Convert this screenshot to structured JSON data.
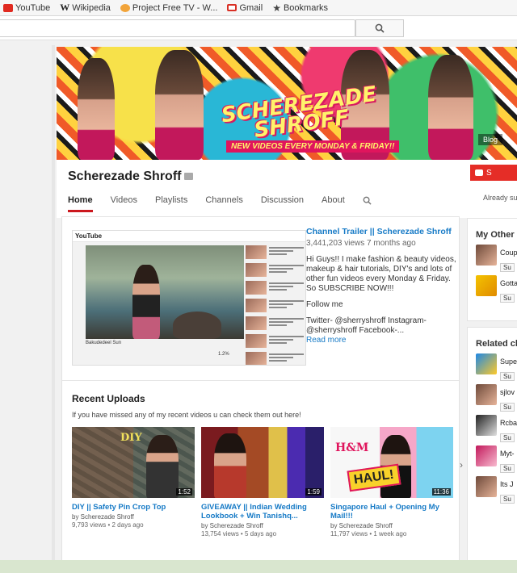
{
  "bookmarks": [
    {
      "label": "YouTube",
      "icon": "youtube-icon"
    },
    {
      "label": "Wikipedia",
      "icon": "wikipedia-icon"
    },
    {
      "label": "Project Free TV - W...",
      "icon": "projectfreetv-icon"
    },
    {
      "label": "Gmail",
      "icon": "gmail-icon"
    },
    {
      "label": "Bookmarks",
      "icon": "star-icon"
    }
  ],
  "search": {
    "placeholder": ""
  },
  "banner": {
    "title_line1": "SCHEREZADE",
    "title_line2": "SHROFF",
    "tagline": "NEW VIDEOS EVERY MONDAY & FRIDAY!!",
    "blog_link": "Blog"
  },
  "channel": {
    "name": "Scherezade Shroff",
    "subscribe_label": "S",
    "already_text": "Already sub",
    "tabs": [
      "Home",
      "Videos",
      "Playlists",
      "Channels",
      "Discussion",
      "About"
    ],
    "active_tab": "Home"
  },
  "trailer": {
    "player_logo": "YouTube",
    "player_caption": "Bakudedeel Sun",
    "player_views": "1.2%",
    "title": "Channel Trailer || Scherezade Shroff",
    "meta": "3,441,203 views  7 months ago",
    "description": "Hi Guys!! I make fashion & beauty videos, makeup & hair tutorials, DIY's and lots of other fun videos every Monday & Friday. So SUBSCRIBE NOW!!!",
    "follow": "Follow me",
    "social": "Twitter- @sherryshroff Instagram- @sherryshroff Facebook-...",
    "read_more": "Read more"
  },
  "uploads": {
    "title": "Recent Uploads",
    "subtitle": "If you have missed any of my recent videos u can check them out here!",
    "thumb_text_1": "DIY",
    "thumb_text_3a": "H&M",
    "thumb_text_3b": "HAUL!",
    "items": [
      {
        "title": "DIY || Safety Pin Crop Top",
        "channel": "by Scherezade Shroff",
        "meta": "9,793 views • 2 days ago",
        "duration": "1:52"
      },
      {
        "title": "GIVEAWAY || Indian Wedding Lookbook + Win Tanishq...",
        "channel": "by Scherezade Shroff",
        "meta": "13,754 views • 5 days ago",
        "duration": "1:59"
      },
      {
        "title": "Singapore Haul + Opening My Mail!!!",
        "channel": "by Scherezade Shroff",
        "meta": "11,797 views • 1 week ago",
        "duration": "11:36"
      }
    ]
  },
  "sidebar": {
    "other_title": "My Other C",
    "other_items": [
      {
        "name": "Coup",
        "sub": "Su"
      },
      {
        "name": "Gotta",
        "sub": "Su"
      }
    ],
    "related_title": "Related ch",
    "related_items": [
      {
        "name": "Supe",
        "sub": "Su"
      },
      {
        "name": "sjlov",
        "sub": "Su"
      },
      {
        "name": "Rcba",
        "sub": "Su"
      },
      {
        "name": "Myt-",
        "sub": "Su"
      },
      {
        "name": "Its J",
        "sub": "Su"
      }
    ]
  },
  "colors": {
    "accent_red": "#cc181e",
    "link_blue": "#167ac6",
    "subscribe_red": "#e52d27"
  }
}
